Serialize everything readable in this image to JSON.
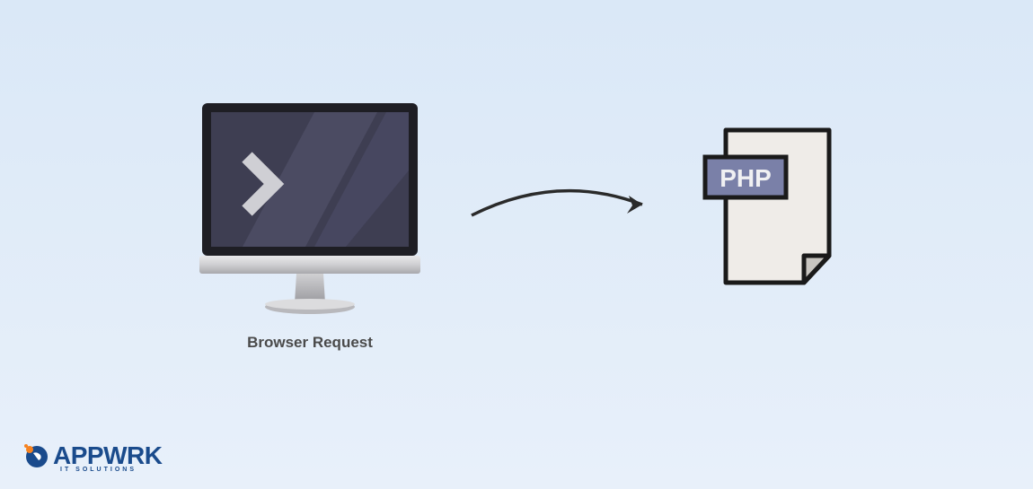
{
  "diagram": {
    "browser_label": "Browser Request",
    "file_label": "PHP"
  },
  "logo": {
    "brand": "APPWRK",
    "tagline": "IT SOLUTIONS"
  },
  "colors": {
    "background": "#dfeaf7",
    "monitor_screen": "#3a3a4d",
    "monitor_screen_light": "#4b4b60",
    "monitor_bezel": "#222228",
    "php_badge": "#7a80a8",
    "file_bg": "#efece8",
    "logo_blue": "#1a4b8c",
    "logo_orange": "#f58220"
  }
}
